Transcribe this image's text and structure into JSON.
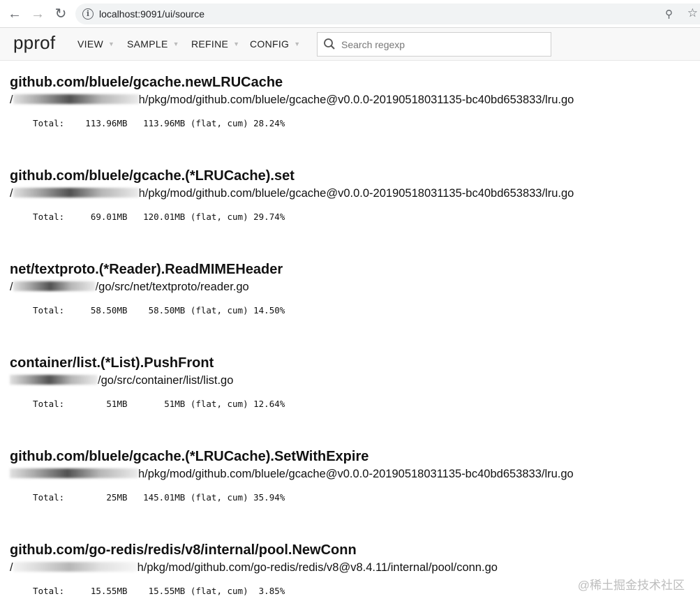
{
  "browser": {
    "url": "localhost:9091/ui/source"
  },
  "header": {
    "logo": "pprof",
    "menu": [
      "VIEW",
      "SAMPLE",
      "REFINE",
      "CONFIG"
    ],
    "search_placeholder": "Search regexp"
  },
  "listings": [
    {
      "function": "github.com/bluele/gcache.newLRUCache",
      "path_prefix": "/",
      "path": "h/pkg/mod/github.com/bluele/gcache@v0.0.0-20190518031135-bc40bd653833/lru.go",
      "total": "  Total:    113.96MB   113.96MB (flat, cum) 28.24%"
    },
    {
      "function": "github.com/bluele/gcache.(*LRUCache).set",
      "path_prefix": "/",
      "path": "h/pkg/mod/github.com/bluele/gcache@v0.0.0-20190518031135-bc40bd653833/lru.go",
      "total": "  Total:     69.01MB   120.01MB (flat, cum) 29.74%"
    },
    {
      "function": "net/textproto.(*Reader).ReadMIMEHeader",
      "path_prefix": "/",
      "path": "/go/src/net/textproto/reader.go",
      "total": "  Total:     58.50MB    58.50MB (flat, cum) 14.50%"
    },
    {
      "function": "container/list.(*List).PushFront",
      "path_prefix": "",
      "path": "/go/src/container/list/list.go",
      "total": "  Total:        51MB       51MB (flat, cum) 12.64%"
    },
    {
      "function": "github.com/bluele/gcache.(*LRUCache).SetWithExpire",
      "path_prefix": "",
      "path": "h/pkg/mod/github.com/bluele/gcache@v0.0.0-20190518031135-bc40bd653833/lru.go",
      "total": "  Total:        25MB   145.01MB (flat, cum) 35.94%"
    },
    {
      "function": "github.com/go-redis/redis/v8/internal/pool.NewConn",
      "path_prefix": "/",
      "path": "h/pkg/mod/github.com/go-redis/redis/v8@v8.4.11/internal/pool/conn.go",
      "total": "  Total:     15.55MB    15.55MB (flat, cum)  3.85%"
    }
  ],
  "watermark": "@稀土掘金技术社区"
}
